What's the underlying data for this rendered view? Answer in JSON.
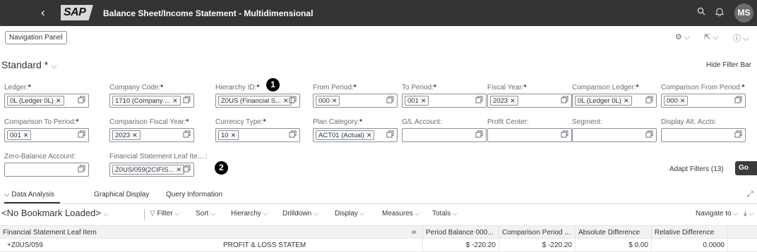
{
  "shell": {
    "back_icon": "‹",
    "logo_text": "SAP",
    "title": "Balance Sheet/Income Statement - Multidimensional",
    "avatar_initials": "MS"
  },
  "toolbar": {
    "nav_panel_label": "Navigation Panel"
  },
  "filterbar": {
    "variant": "Standard *",
    "hide_filter_bar": "Hide Filter Bar",
    "adapt_filters": "Adapt Filters (13)",
    "go_label": "Go",
    "marker_1": "1",
    "marker_2": "2",
    "fields": [
      {
        "label": "Ledger:",
        "required": true,
        "token": "0L (Ledger 0L)"
      },
      {
        "label": "Company Code:",
        "required": true,
        "token": "1710 (Company ..."
      },
      {
        "label": "Hierarchy ID:",
        "required": true,
        "token": "Z0US (Financial S..."
      },
      {
        "label": "From Period:",
        "required": true,
        "token": "000"
      },
      {
        "label": "To Period:",
        "required": true,
        "token": "001"
      },
      {
        "label": "Fiscal Year:",
        "required": true,
        "token": "2023"
      },
      {
        "label": "Comparison Ledger:",
        "required": true,
        "token": "0L (Ledger 0L)"
      },
      {
        "label": "Comparison From Period:",
        "required": true,
        "token": "000"
      },
      {
        "label": "Comparison To Period:",
        "required": true,
        "token": "001"
      },
      {
        "label": "Comparison Fiscal Year:",
        "required": true,
        "token": "2023"
      },
      {
        "label": "Currency Type:",
        "required": true,
        "token": "10"
      },
      {
        "label": "Plan Category:",
        "required": true,
        "token": "ACT01 (Actual)"
      },
      {
        "label": "G/L Account:",
        "required": false,
        "token": ""
      },
      {
        "label": "Profit Center:",
        "required": false,
        "token": ""
      },
      {
        "label": "Segment:",
        "required": false,
        "token": ""
      },
      {
        "label": "Display Alt. Accts:",
        "required": false,
        "token": ""
      },
      {
        "label": "Zero-Balance Account:",
        "required": false,
        "token": ""
      },
      {
        "label": "Financial Statement Leaf Ite... :",
        "required": false,
        "token": "Z0US/059(2CIFIS..."
      }
    ]
  },
  "tabs": [
    {
      "label": "Data Analysis"
    },
    {
      "label": "Graphical Display"
    },
    {
      "label": "Query Information"
    }
  ],
  "query_toolbar": {
    "bookmark": "<No Bookmark Loaded>",
    "items": [
      "Filter",
      "Sort",
      "Hierarchy",
      "Drilldown",
      "Display",
      "Measures",
      "Totals"
    ],
    "navigate_to": "Navigate to"
  },
  "table": {
    "columns": [
      "Financial Statement Leaf Item",
      "Period Balance 000...",
      "Comparison Period ...",
      "Absolute Difference",
      "Relative Difference"
    ],
    "rows": [
      {
        "item": "Z0US/059",
        "text": "PROFIT & LOSS STATEM",
        "period_balance": "$ -220.20",
        "comparison_period": "$ -220.20",
        "absolute_difference": "$ 0.00",
        "relative_difference": "0.0000"
      }
    ]
  }
}
